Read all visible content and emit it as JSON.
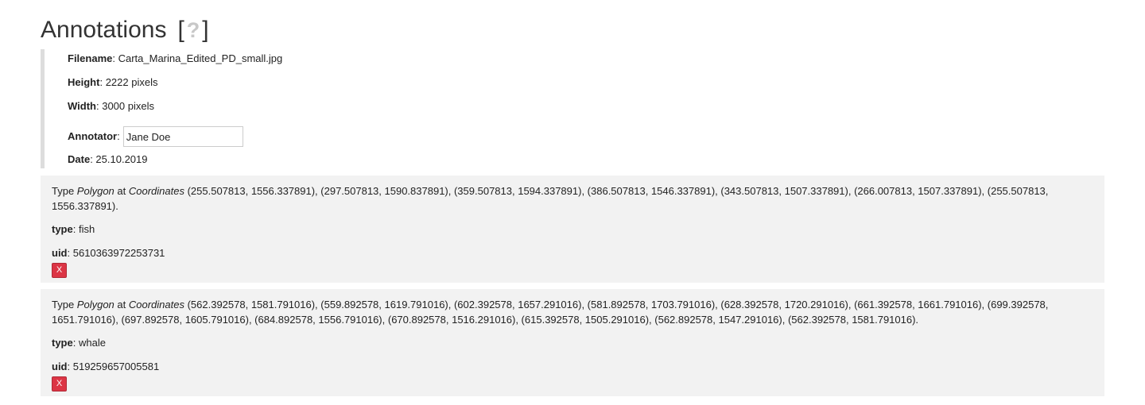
{
  "heading": {
    "title": "Annotations",
    "help_open": "[",
    "help_icon": "?",
    "help_close": "]"
  },
  "meta": {
    "filename_label": "Filename",
    "filename": "Carta_Marina_Edited_PD_small.jpg",
    "height_label": "Height",
    "height": "2222 pixels",
    "width_label": "Width",
    "width": "3000 pixels",
    "annotator_label": "Annotator",
    "annotator": "Jane Doe",
    "date_label": "Date",
    "date": "25.10.2019"
  },
  "annotations": [
    {
      "prefix": "Type ",
      "shape": "Polygon",
      "middle": " at ",
      "coords_label": "Coordinates",
      "coords": " (255.507813, 1556.337891), (297.507813, 1590.837891), (359.507813, 1594.337891), (386.507813, 1546.337891), (343.507813, 1507.337891), (266.007813, 1507.337891), (255.507813, 1556.337891).",
      "type_label": "type",
      "type": "fish",
      "uid_label": "uid",
      "uid": "5610363972253731",
      "delete_label": "X"
    },
    {
      "prefix": "Type ",
      "shape": "Polygon",
      "middle": " at ",
      "coords_label": "Coordinates",
      "coords": " (562.392578, 1581.791016), (559.892578, 1619.791016), (602.392578, 1657.291016), (581.892578, 1703.791016), (628.392578, 1720.291016), (661.392578, 1661.791016), (699.392578, 1651.791016), (697.892578, 1605.791016), (684.892578, 1556.791016), (670.892578, 1516.291016), (615.392578, 1505.291016), (562.892578, 1547.291016), (562.392578, 1581.791016).",
      "type_label": "type",
      "type": "whale",
      "uid_label": "uid",
      "uid": "519259657005581",
      "delete_label": "X"
    }
  ],
  "colors": {
    "panel_bg": "#f2f2f2",
    "delete_button": "#dc3545",
    "meta_border": "#dddddd"
  }
}
